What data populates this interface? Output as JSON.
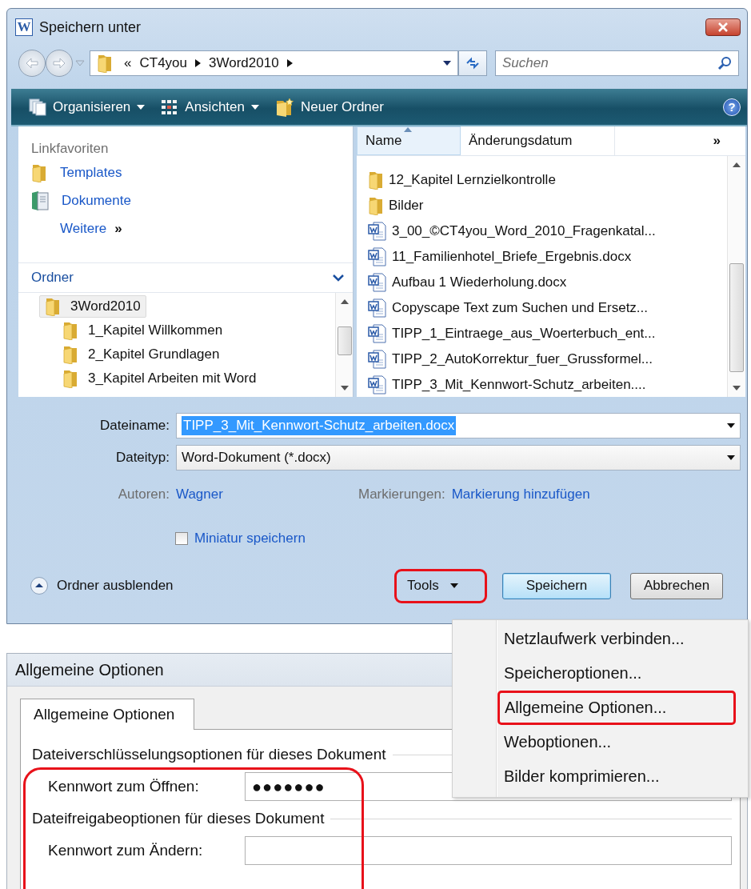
{
  "save_dialog": {
    "app_icon_letter": "W",
    "title": "Speichern unter",
    "address": {
      "prefix": "«",
      "parts": [
        "CT4you",
        "3Word2010"
      ]
    },
    "search": {
      "placeholder": "Suchen"
    },
    "toolbar": [
      {
        "label": "Organisieren",
        "kind": "menu"
      },
      {
        "label": "Ansichten",
        "kind": "menu"
      },
      {
        "label": "Neuer Ordner",
        "kind": "button"
      }
    ],
    "help_glyph": "?",
    "favorites": {
      "title": "Linkfavoriten",
      "items": [
        {
          "label": "Templates",
          "kind": "folder"
        },
        {
          "label": "Dokumente",
          "kind": "library"
        }
      ],
      "more": "Weitere",
      "more_glyph": "»"
    },
    "folders": {
      "title": "Ordner",
      "expanded": true,
      "tree": [
        {
          "label": "3Word2010",
          "selected": true,
          "children": [
            {
              "label": "1_Kapitel   Willkommen",
              "selected": false
            },
            {
              "label": "2_Kapitel   Grundlagen",
              "selected": false
            },
            {
              "label": "3_Kapitel   Arbeiten mit Word",
              "selected": false
            }
          ]
        }
      ]
    },
    "columns": [
      {
        "label": "Name",
        "sorted": true
      },
      {
        "label": "Änderungsdatum",
        "sorted": false
      }
    ],
    "columns_more": "»",
    "files": [
      {
        "name": "12_Kapitel   Lernzielkontrolle",
        "kind": "folder"
      },
      {
        "name": "Bilder",
        "kind": "folder"
      },
      {
        "name": "3_00_©CT4you_Word_2010_Fragenkatal...",
        "kind": "document"
      },
      {
        "name": "11_Familienhotel_Briefe_Ergebnis.docx",
        "kind": "document"
      },
      {
        "name": "Aufbau 1 Wiederholung.docx",
        "kind": "document"
      },
      {
        "name": "Copyscape Text zum Suchen und Ersetz...",
        "kind": "document"
      },
      {
        "name": "TIPP_1_Eintraege_aus_Woerterbuch_ent...",
        "kind": "document"
      },
      {
        "name": "TIPP_2_AutoKorrektur_fuer_Grussformel...",
        "kind": "document"
      },
      {
        "name": "TIPP_3_Mit_Kennwort-Schutz_arbeiten....",
        "kind": "document"
      }
    ],
    "filename": {
      "label": "Dateiname:",
      "value": "TIPP_3_Mit_Kennwort-Schutz_arbeiten.docx",
      "value_selected": true
    },
    "filetype": {
      "label": "Dateityp:",
      "value": "Word-Dokument (*.docx)"
    },
    "authors": {
      "label": "Autoren:",
      "value": "Wagner"
    },
    "tags": {
      "label": "Markierungen:",
      "value": "Markierung hinzufügen"
    },
    "thumbnail": {
      "label": "Miniatur speichern",
      "checked": false
    },
    "hide_folders": "Ordner ausblenden",
    "buttons": [
      {
        "label": "Tools",
        "kind": "menu",
        "highlighted": true
      },
      {
        "label": "Speichern",
        "kind": "default",
        "highlighted": false
      },
      {
        "label": "Abbrechen",
        "kind": "normal",
        "highlighted": false
      }
    ]
  },
  "tools_menu": [
    {
      "label": "Netzlaufwerk verbinden...",
      "highlighted": false
    },
    {
      "label": "Speicheroptionen...",
      "highlighted": false
    },
    {
      "label": "Allgemeine Optionen...",
      "highlighted": true
    },
    {
      "label": "Weboptionen...",
      "highlighted": false
    },
    {
      "label": "Bilder komprimieren...",
      "highlighted": false
    }
  ],
  "options_dialog": {
    "title": "Allgemeine Optionen",
    "tabs": [
      {
        "label": "Allgemeine Optionen",
        "selected": true
      }
    ],
    "highlighted": true,
    "sections": [
      {
        "title": "Dateiverschlüsselungsoptionen für dieses Dokument",
        "field": {
          "label": "Kennwort zum Öffnen:",
          "value": "●●●●●●●"
        }
      },
      {
        "title": "Dateifreigabeoptionen für dieses Dokument",
        "field": {
          "label": "Kennwort zum Ändern:"
        }
      }
    ]
  }
}
